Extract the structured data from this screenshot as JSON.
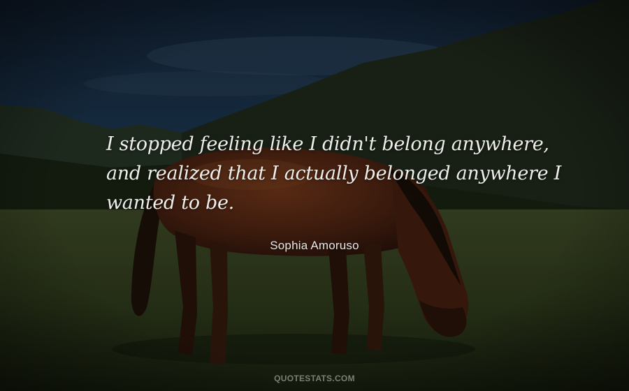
{
  "quote": {
    "lines": [
      "I stopped feeling like I didn't belong anywhere,",
      "and realized that I actually belonged anywhere I",
      "wanted to be."
    ]
  },
  "author": "Sophia Amoruso",
  "watermark": "QUOTESTATS.COM",
  "colors": {
    "sky": "#1d3550",
    "mountain": "#1f2a1c",
    "grass": "#3a4a22",
    "horse": "#5a2a16",
    "text": "#eeeeea"
  }
}
